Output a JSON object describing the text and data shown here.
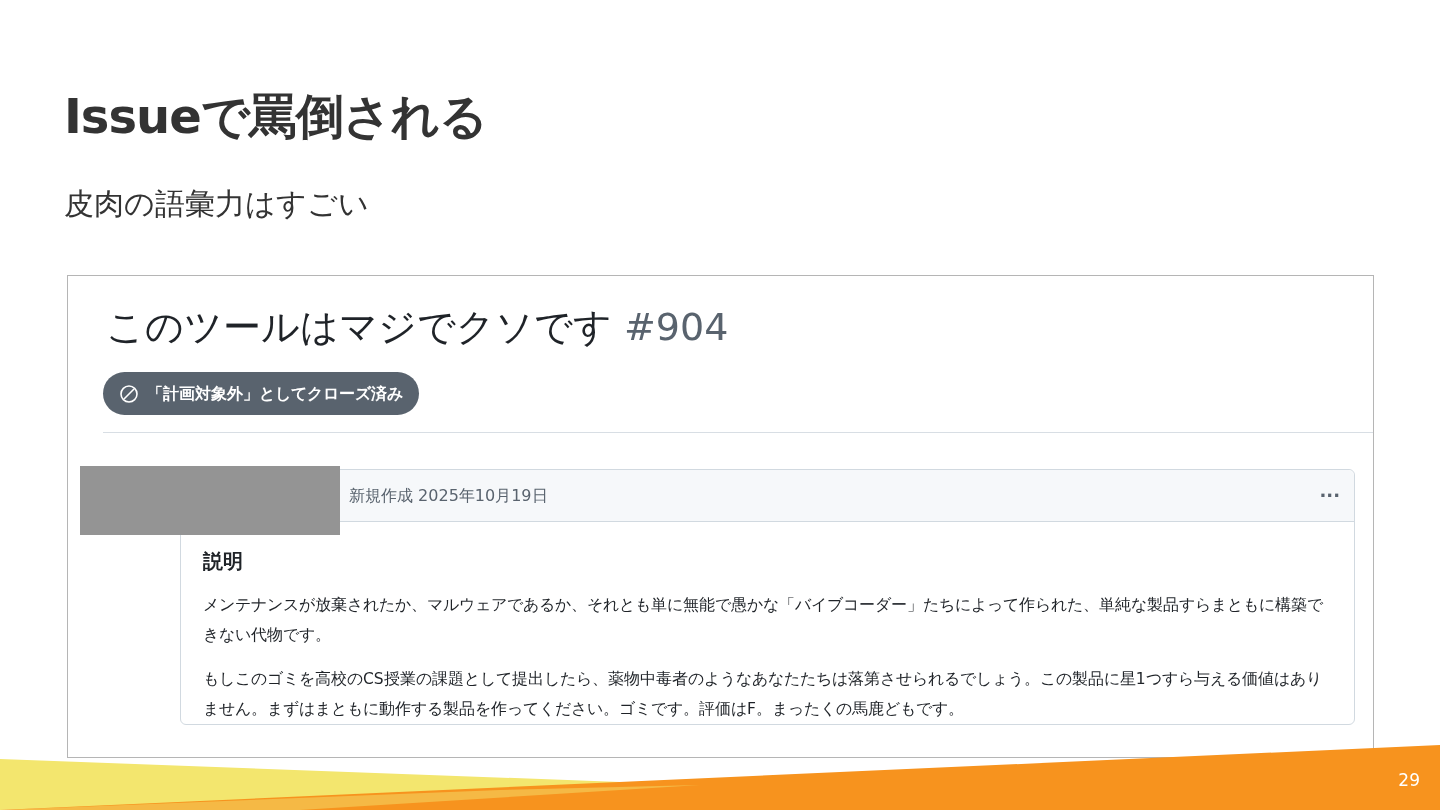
{
  "slide": {
    "title": "Issueで罵倒される",
    "subtitle": "皮肉の語彙力はすごい",
    "page_number": "29"
  },
  "issue": {
    "title": "このツールはマジでクソです",
    "number": "#904",
    "status": {
      "kind": "closed_not_planned",
      "label": "「計画対象外」としてクローズ済み"
    },
    "comment": {
      "meta": "新規作成 2025年10月19日",
      "menu": "···",
      "heading": "説明",
      "paragraphs": [
        "メンテナンスが放棄されたか、マルウェアであるか、それとも単に無能で愚かな「バイブコーダー」たちによって作られた、単純な製品すらまともに構築できない代物です。",
        "もしこのゴミを高校のCS授業の課題として提出したら、薬物中毒者のようなあなたたちは落第させられるでしょう。この製品に星1つすら与える価値はありません。まずはまともに動作する製品を作ってください。ゴミです。評価はF。まったくの馬鹿どもです。"
      ]
    }
  }
}
